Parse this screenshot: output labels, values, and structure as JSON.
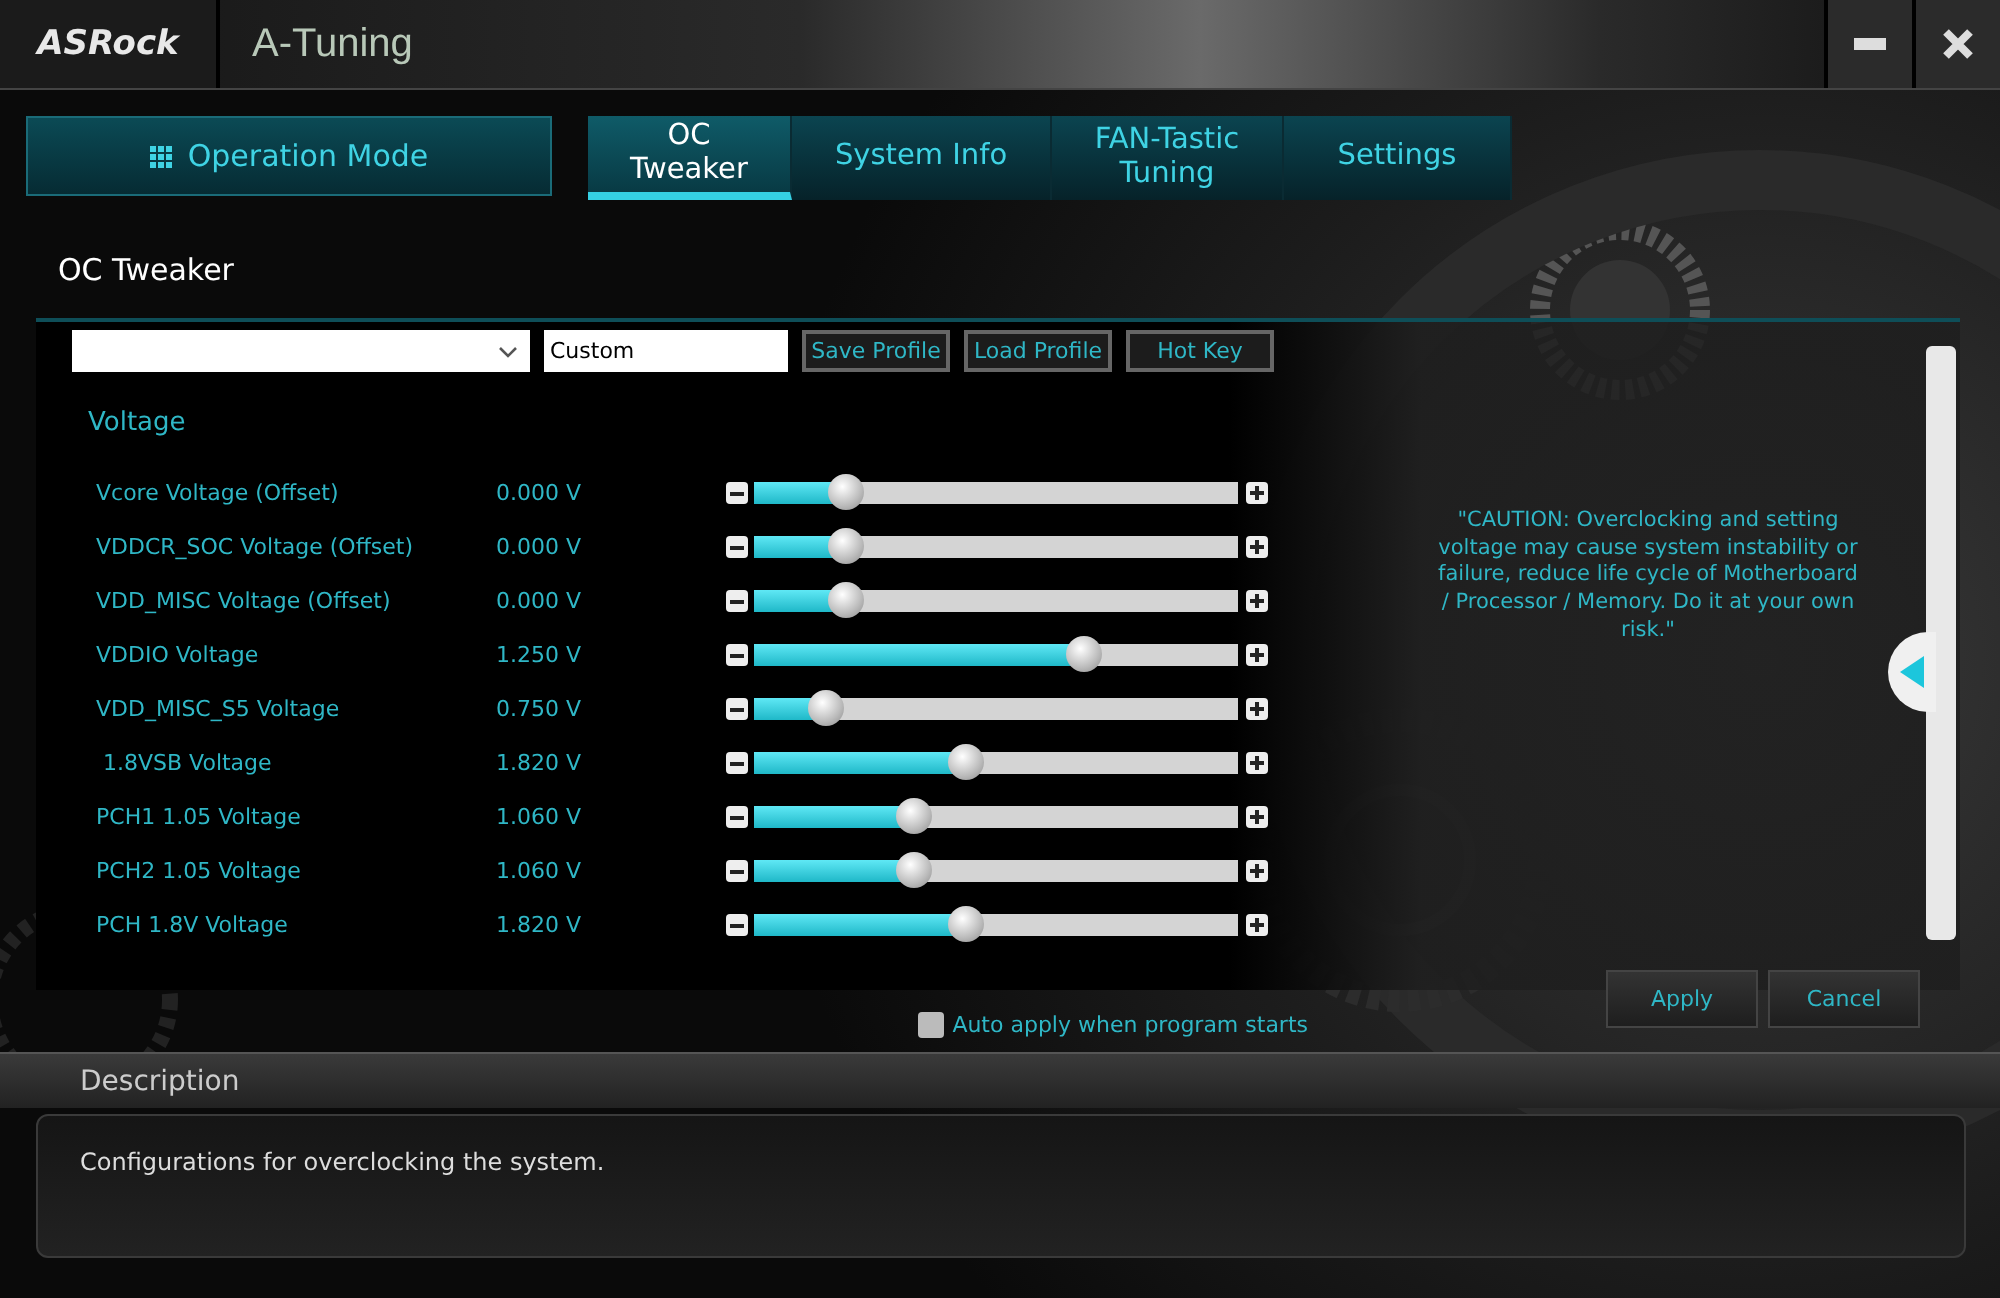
{
  "window": {
    "logo": "ASRock",
    "title": "A-Tuning"
  },
  "operation_mode": {
    "label": "Operation Mode"
  },
  "tabs": [
    {
      "label": "OC Tweaker",
      "selected": true
    },
    {
      "label": "System Info",
      "selected": false
    },
    {
      "label": "FAN-Tastic Tuning",
      "selected": false
    },
    {
      "label": "Settings",
      "selected": false
    }
  ],
  "page_title": "OC Tweaker",
  "profile": {
    "value": "Custom",
    "buttons": [
      "Save Profile",
      "Load Profile",
      "Hot Key"
    ]
  },
  "section": "Voltage",
  "voltages": [
    {
      "name": "Vcore Voltage (Offset)",
      "reading": "0.000 V",
      "level": 0.19
    },
    {
      "name": "VDDCR_SOC Voltage (Offset)",
      "reading": "0.000 V",
      "level": 0.19
    },
    {
      "name": "VDD_MISC Voltage (Offset)",
      "reading": "0.000 V",
      "level": 0.19
    },
    {
      "name": "VDDIO Voltage",
      "reading": "1.250 V",
      "level": 0.68
    },
    {
      "name": "VDD_MISC_S5 Voltage",
      "reading": "0.750 V",
      "level": 0.15
    },
    {
      "name": " 1.8VSB Voltage",
      "reading": "1.820 V",
      "level": 0.44
    },
    {
      "name": "PCH1 1.05 Voltage",
      "reading": "1.060 V",
      "level": 0.33
    },
    {
      "name": "PCH2 1.05 Voltage",
      "reading": "1.060 V",
      "level": 0.33
    },
    {
      "name": "PCH 1.8V Voltage",
      "reading": "1.820 V",
      "level": 0.44
    }
  ],
  "caution": "\"CAUTION: Overclocking and setting voltage may cause system instability or failure, reduce life cycle of Motherboard / Processor / Memory. Do it at your own risk.\"",
  "auto_apply": {
    "label": "Auto apply when program starts",
    "checked": false
  },
  "buttons": [
    "Apply",
    "Cancel"
  ],
  "description": {
    "title": "Description",
    "text": "Configurations for overclocking the system."
  }
}
